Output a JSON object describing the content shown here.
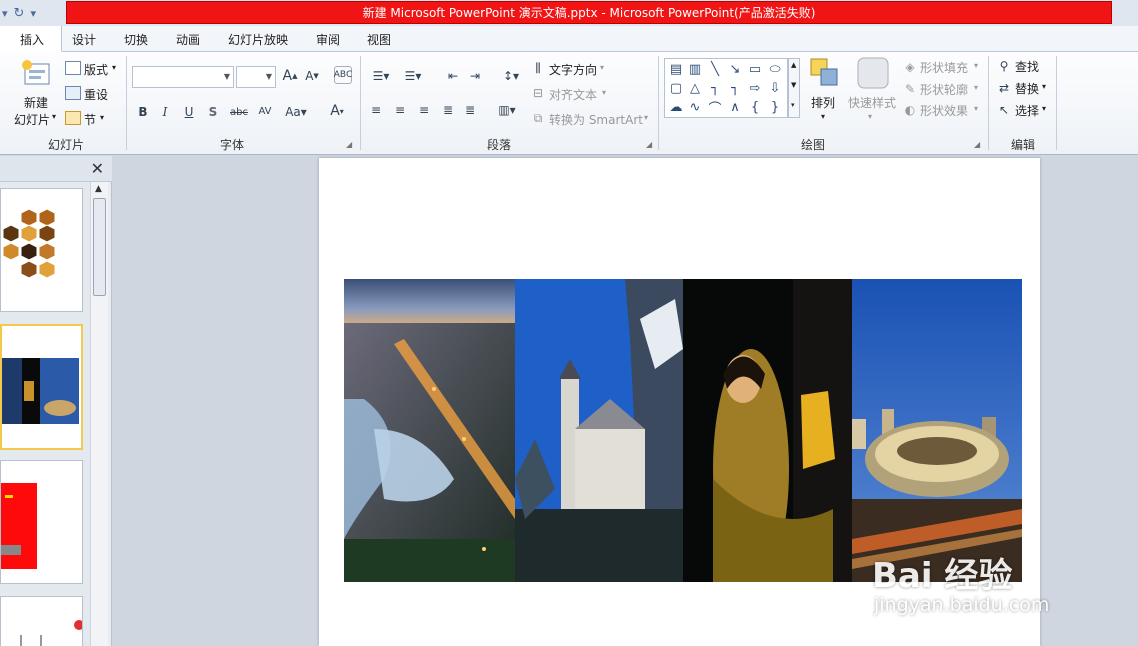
{
  "title": "新建 Microsoft PowerPoint 演示文稿.pptx - Microsoft PowerPoint(产品激活失败)",
  "tabs": [
    "插入",
    "设计",
    "切换",
    "动画",
    "幻灯片放映",
    "审阅",
    "视图"
  ],
  "ribbon": {
    "slides": {
      "label": "幻灯片",
      "new_slide_1": "新建",
      "new_slide_2": "幻灯片",
      "layout": "版式",
      "reset": "重设",
      "section": "节"
    },
    "font": {
      "label": "字体"
    },
    "paragraph": {
      "label": "段落",
      "text_direction": "文字方向",
      "align_text": "对齐文本",
      "convert_smartart": "转换为 SmartArt"
    },
    "drawing": {
      "label": "绘图",
      "arrange": "排列",
      "quick_styles": "快速样式",
      "shape_fill": "形状填充",
      "shape_outline": "形状轮廓",
      "shape_effects": "形状效果"
    },
    "editing": {
      "label": "编辑",
      "find": "查找",
      "replace": "替换",
      "select": "选择"
    }
  },
  "watermark": {
    "logo": "Bai 经验",
    "url": "jingyan.baidu.com"
  },
  "colors": {
    "title_bar": "#f01414",
    "selected_thumb_border": "#f2c94c"
  }
}
